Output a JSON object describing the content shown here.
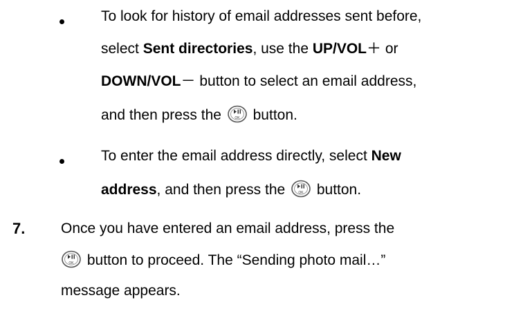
{
  "bullets": [
    {
      "lines": [
        {
          "t1": "To look for history of email addresses sent before,"
        },
        {
          "t1": "select ",
          "b1": "Sent directories",
          "t2": ", use the ",
          "b2": "UP/VOL",
          "sym": "＋",
          "t3": " or"
        },
        {
          "b1": "DOWN/VOL",
          "sym": "－",
          "t1": " button to select an email address,"
        },
        {
          "t1": "and then press the ",
          "t2": " button."
        }
      ]
    },
    {
      "lines": [
        {
          "t1": "To enter the email address directly, select ",
          "b1": "New"
        },
        {
          "b1": "address",
          "t1": ", and then press the ",
          "t2": " button."
        }
      ]
    }
  ],
  "step": {
    "number": "7.",
    "lines": [
      {
        "t1": "Once you have entered an email address, press the"
      },
      {
        "t1": " button to proceed. The “Sending photo mail…”"
      },
      {
        "t1": "message appears."
      }
    ]
  },
  "icons": {
    "ok_button": "play-pause-ok-button-icon"
  }
}
